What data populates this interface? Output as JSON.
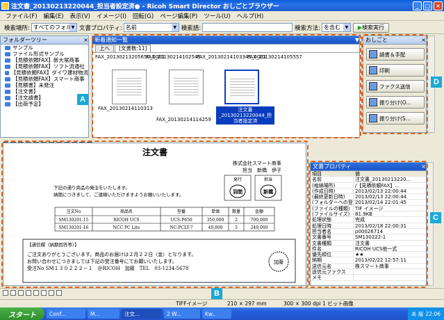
{
  "window": {
    "title": "注文書_20130213220044_担当者設定済● - Ricoh Smart Director おしごとブラウザー",
    "buttons": [
      "_",
      "□",
      "×"
    ]
  },
  "menu": [
    "ファイル(F)",
    "編集(E)",
    "表示(V)",
    "イメージ(I)",
    "回転(G)",
    "ページ編集(P)",
    "ツール(U)",
    "ヘルプ(H)"
  ],
  "search": {
    "place_label": "検索場所:",
    "place_value": "すべてのフォルダー",
    "prop_label": "文書プロパティ:",
    "prop_value": "名前",
    "word_label": "検索語:",
    "method_label": "検索方法:",
    "method_value": "を含む",
    "exec": "検索実行"
  },
  "folder_tree": {
    "title": "フォルダーツリー",
    "items": [
      "サンプル",
      "ファイル形式サンプル",
      "【見積依頼FAX】新大塚商事",
      "【見積依頼FAX】ソフト流通社",
      "【見積依頼FAX】ダイワ建材物流",
      "【見積依頼FAX】スマート商事",
      "【見積書】未発注",
      "【注文書】",
      "【注文請書】",
      "【出荷予定】"
    ]
  },
  "new_list": {
    "title": "新着通知一覧",
    "tabs": [
      "上へ",
      "[文書数:11]"
    ],
    "top_labels": [
      "FAX_20130213205650_0001",
      "FAX_20130214102545",
      "FAX_20130214103345_0001",
      "FAX_20130214105557"
    ],
    "thumbs": [
      "FAX_20130214110313",
      "FAX_20130214114259",
      "注文書_20130213220044_担当者設定済"
    ]
  },
  "oshigoto": {
    "title": "おしごと",
    "buttons": [
      "請書＆手配",
      "印刷",
      "ファクス送信",
      "振り分け(O...",
      "振り分け(S..."
    ]
  },
  "doc": {
    "title": "注文書",
    "company": "株式会社スマート商事",
    "person": "担当　新橋　伊子",
    "stamp_labels": [
      "発行",
      "担当"
    ],
    "stamp_names": [
      "羽間",
      "新橋"
    ],
    "intro1": "下記の通り商品の発注をいたします。",
    "intro2": "納期につきまして、ご連絡いただけますようお願いいたします。",
    "headers": [
      "注文No",
      "商品名",
      "型番",
      "単価",
      "数量",
      "金額"
    ],
    "rows": [
      [
        "SM130201-15",
        "RICOH UCS",
        "UCS-P650",
        "350,000",
        "2",
        "700,000"
      ],
      [
        "SM130201-16",
        "NCC PC Lite",
        "NC-PCLT-7",
        "49,800",
        "5",
        "249,000"
      ]
    ],
    "reply_title": "【通信欄（納期回答等）】",
    "reply1": "ご注文ありがとうございます。商品のお届けは２月２２日（金）となります。",
    "reply2": "お問い合わせにつきましては下記の受注番号にてお願いいたします。",
    "reply3": "受注No SM１３０２２２－１　＠RICOH　加藤　TEL　03-1234-5678",
    "stamp_round": "加藤"
  },
  "props": {
    "title": "文書プロパティ",
    "head": [
      "項目",
      "値"
    ],
    "rows": [
      [
        "名前",
        "注文書_20130213220..."
      ],
      [
        "(格納場所)",
        "/【見積依頼FAX】..."
      ],
      [
        "(作成日時)",
        "2013/02/13 22:00:44"
      ],
      [
        "(最終更新日時)",
        "2013/02/13 22:00:44"
      ],
      [
        "(フォルダーへの登録日時)",
        "2013/02/14 22:01:45"
      ],
      [
        "(ファイルの種類)",
        "TIF イメージ"
      ],
      [
        "(ファイルサイズ)",
        "81.9KB"
      ],
      [
        "処理状態",
        "完成"
      ],
      [
        "処理日時",
        "2013/02/18 22:00:31"
      ],
      [
        "担当者名",
        "p00026714"
      ],
      [
        "文書番号",
        "SM130222-1"
      ],
      [
        "文書種類",
        "注文書"
      ],
      [
        "件名",
        "RICOH UCS他一式"
      ],
      [
        "優先順位",
        "★★"
      ],
      [
        "納期",
        "2013/02/22 12:57:11"
      ],
      [
        "送信元名",
        "株スマート商事"
      ],
      [
        "送信元ファクス",
        ""
      ],
      [
        "メモ",
        ""
      ]
    ]
  },
  "status": {
    "format": "TIFFイメージ",
    "size": "210 × 297 mm",
    "res": "300 × 300 dpi 1 ビット画像"
  },
  "taskbar": {
    "start": "スタート",
    "tasks": [
      "Conf...",
      "M...",
      "注文...",
      "2 W...",
      "Kw.."
    ],
    "clock": "22:06",
    "ime": "あ 般"
  },
  "callouts": [
    "A",
    "B",
    "C",
    "D"
  ],
  "colors": {
    "callout_border": "#e8621b",
    "callout_badge": "#1aa9d6",
    "title_blue": "#2b73e6"
  }
}
